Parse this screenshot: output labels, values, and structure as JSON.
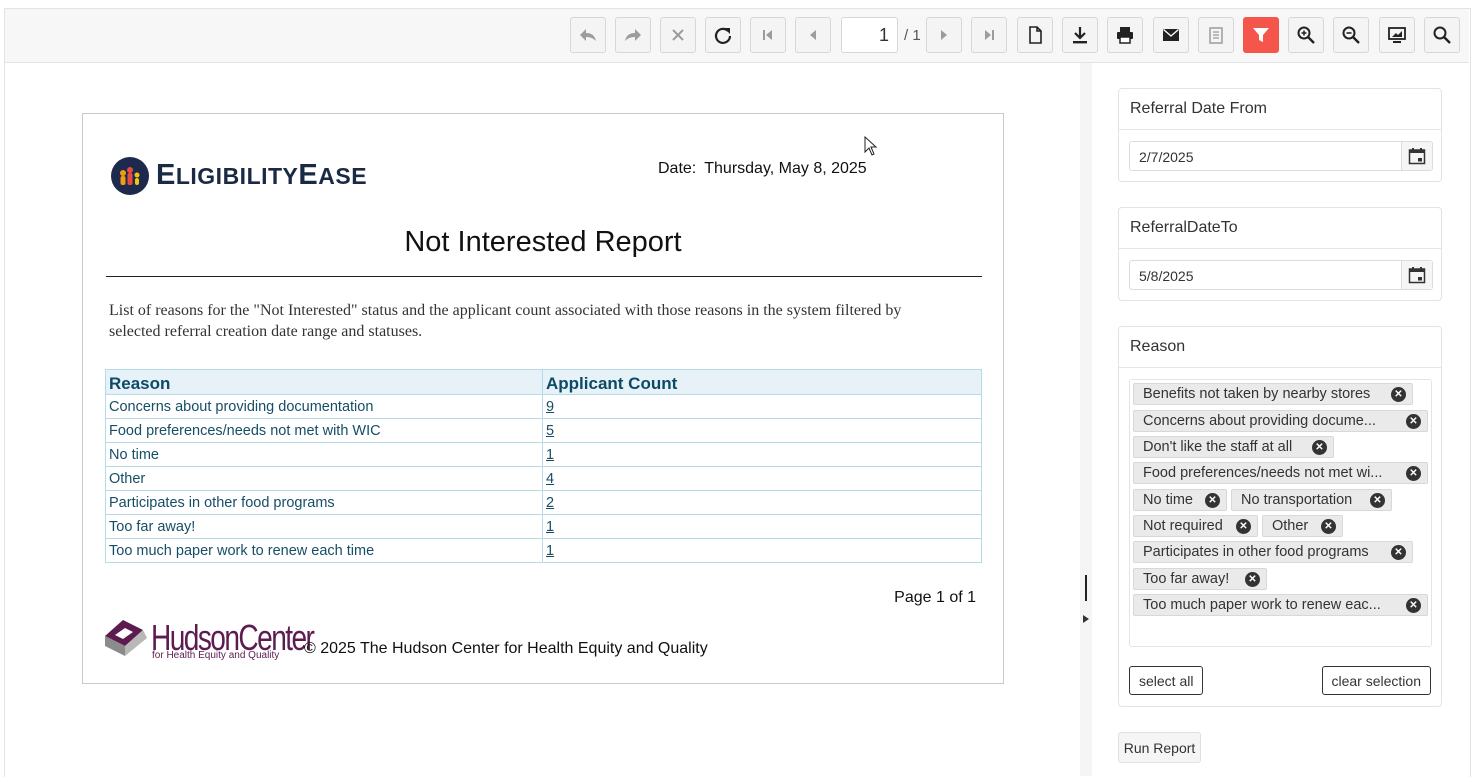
{
  "toolbar": {
    "page_current": "1",
    "page_total": "/ 1",
    "accent": "#f4564b"
  },
  "report": {
    "logo_brand_big1": "E",
    "logo_brand_small1": "LIGIBILITY",
    "logo_brand_big2": "E",
    "logo_brand_small2": "ASE",
    "date_label": "Date:",
    "date_value": "Thursday, May 8, 2025",
    "title": "Not Interested Report",
    "description": "List of reasons for the \"Not Interested\" status and the applicant count associated with those reasons in the system filtered by selected referral creation date range and statuses.",
    "columns": [
      "Reason",
      "Applicant Count"
    ],
    "rows": [
      {
        "reason": "Concerns about providing documentation",
        "count": "9"
      },
      {
        "reason": "Food preferences/needs not met with WIC",
        "count": "5"
      },
      {
        "reason": "No time",
        "count": "1"
      },
      {
        "reason": "Other",
        "count": "4"
      },
      {
        "reason": "Participates in other food programs",
        "count": "2"
      },
      {
        "reason": "Too far away!",
        "count": "1"
      },
      {
        "reason": "Too much paper work to renew each time",
        "count": "1"
      }
    ],
    "page_label": "Page 1 of 1",
    "footer_logo_text": "HudsonCenter",
    "footer_logo_sub": "for Health Equity and Quality",
    "copyright": "© 2025 The Hudson Center for Health Equity and Quality"
  },
  "params": {
    "from_label": "Referral Date From",
    "from_value": "2/7/2025",
    "to_label": "ReferralDateTo",
    "to_value": "5/8/2025",
    "reason_label": "Reason",
    "reason_tags": [
      "Benefits not taken by nearby stores",
      "Concerns about providing docume...",
      "Don't like the staff at all",
      "Food preferences/needs not met wi...",
      "No time",
      "No transportation",
      "Not required",
      "Other",
      "Participates in other food programs",
      "Too far away!",
      "Too much paper work to renew eac..."
    ],
    "select_all": "select all",
    "clear_selection": "clear selection",
    "run_report": "Run Report"
  }
}
